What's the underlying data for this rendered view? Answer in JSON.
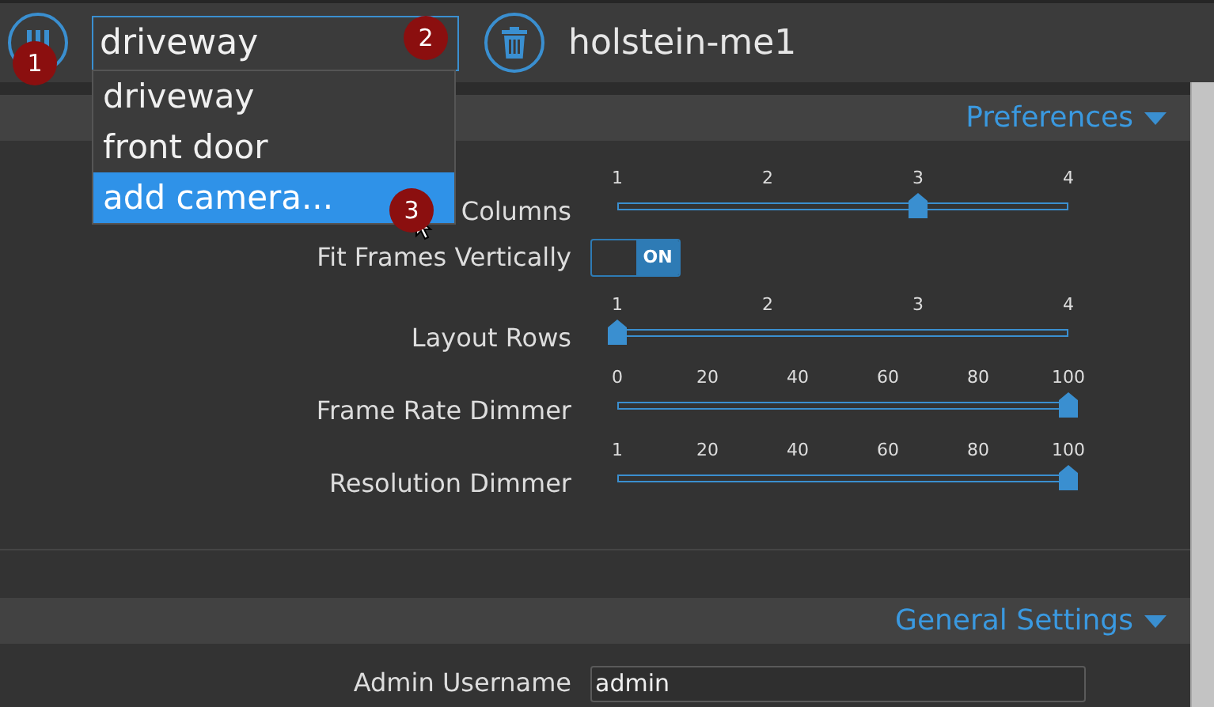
{
  "toolbar": {
    "camera_select": {
      "value": "driveway",
      "expanded": true,
      "options": [
        {
          "label": "driveway",
          "highlighted": false
        },
        {
          "label": "front door",
          "highlighted": false
        },
        {
          "label": "add camera...",
          "highlighted": true
        }
      ]
    },
    "title": "holstein-me1"
  },
  "annotations": [
    {
      "label": "1"
    },
    {
      "label": "2"
    },
    {
      "label": "3"
    }
  ],
  "sections": [
    {
      "title": "Preferences",
      "expanded": true,
      "rows": [
        {
          "kind": "slider",
          "label": "Columns",
          "ticks": [
            "1",
            "2",
            "3",
            "4"
          ],
          "level": 0.667
        },
        {
          "kind": "toggle",
          "label": "Fit Frames Vertically",
          "on": true,
          "text": "ON"
        },
        {
          "kind": "slider",
          "label": "Layout Rows",
          "ticks": [
            "1",
            "2",
            "3",
            "4"
          ],
          "level": 0
        },
        {
          "kind": "slider",
          "label": "Frame Rate Dimmer",
          "ticks": [
            "0",
            "20",
            "40",
            "60",
            "80",
            "100"
          ],
          "level": 1
        },
        {
          "kind": "slider",
          "label": "Resolution Dimmer",
          "ticks": [
            "1",
            "20",
            "40",
            "60",
            "80",
            "100"
          ],
          "level": 1
        }
      ]
    },
    {
      "title": "General Settings",
      "expanded": true,
      "rows": [
        {
          "kind": "text",
          "label": "Admin Username",
          "value": "admin"
        }
      ]
    }
  ]
}
